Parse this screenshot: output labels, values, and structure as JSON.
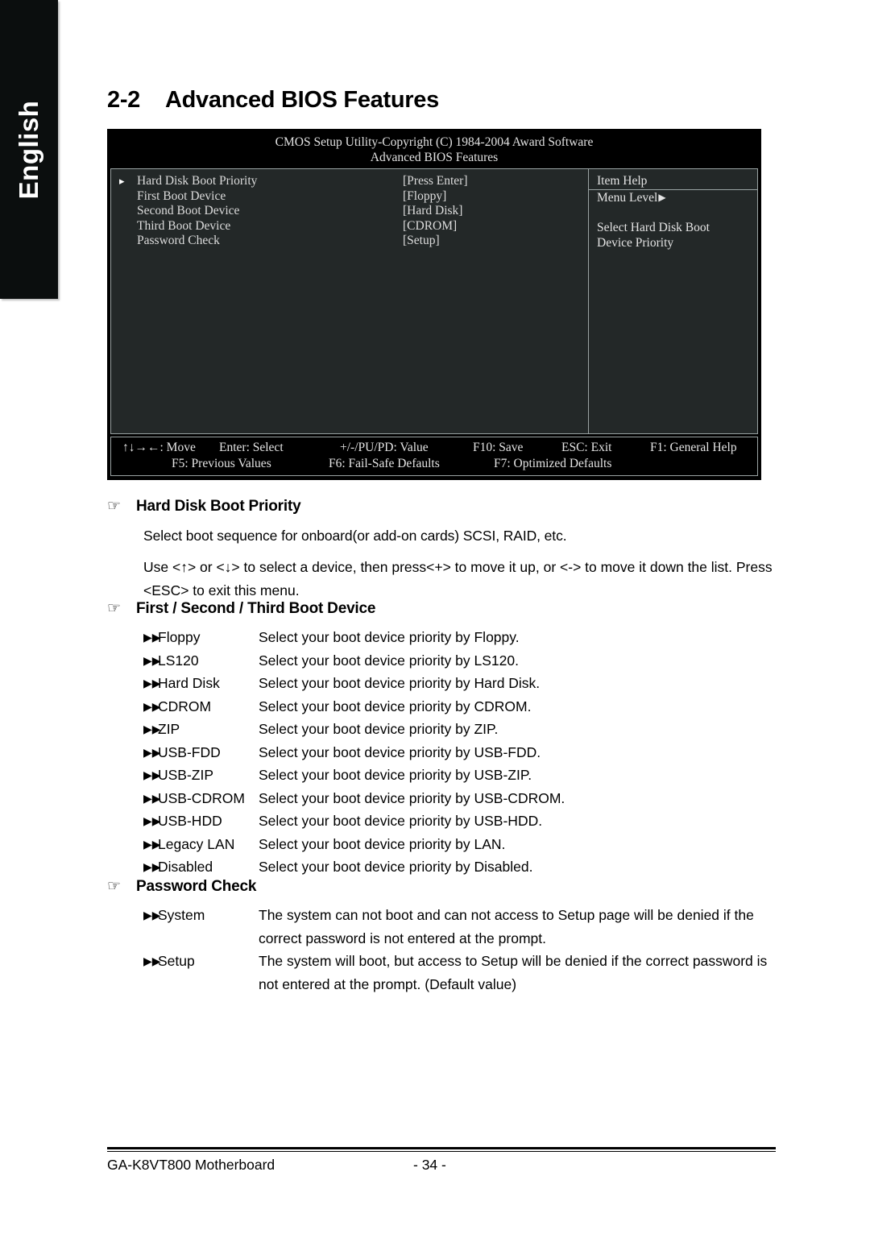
{
  "language_tab": {
    "label": "English"
  },
  "chapter": {
    "number": "2-2",
    "title": "Advanced BIOS Features"
  },
  "bios_screen": {
    "title": "CMOS Setup Utility-Copyright (C) 1984-2004 Award Software",
    "subtitle": "Advanced BIOS Features",
    "options": [
      {
        "arrow": "▸",
        "label": "Hard Disk Boot Priority",
        "value": "[Press Enter]"
      },
      {
        "arrow": "",
        "label": "First Boot Device",
        "value": "[Floppy]"
      },
      {
        "arrow": "",
        "label": "Second Boot Device",
        "value": "[Hard Disk]"
      },
      {
        "arrow": "",
        "label": "Third Boot Device",
        "value": "[CDROM]"
      },
      {
        "arrow": "",
        "label": "Password Check",
        "value": "[Setup]"
      }
    ],
    "item_help": {
      "heading": "Item Help",
      "menu_level_label": "Menu Level",
      "menu_level_arrow": "▶",
      "description_line1": "Select Hard Disk Boot",
      "description_line2": "Device Priority"
    },
    "footer": {
      "row1": [
        "↑↓→←: Move",
        "Enter: Select",
        "+/-/PU/PD: Value",
        "F10: Save",
        "ESC: Exit",
        "F1: General Help"
      ],
      "row2": [
        "F5: Previous Values",
        "F6: Fail-Safe Defaults",
        "F7: Optimized Defaults"
      ]
    }
  },
  "sections": {
    "hard_disk_boot_priority": {
      "icon": "pointing-hand",
      "heading": "Hard Disk Boot Priority",
      "paragraph1": "Select boot sequence for onboard(or add-on cards) SCSI, RAID, etc.",
      "paragraph2_line1": "Use <↑> or <↓> to select a device, then press<+> to move it up, or <-> to move it down the list. Press",
      "paragraph2_line2": "<ESC> to exit this menu."
    },
    "boot_device": {
      "icon": "pointing-hand",
      "heading": "First / Second / Third Boot Device",
      "bullet": "▶▶",
      "items": [
        {
          "term": "Floppy",
          "desc": "Select your boot device priority by Floppy."
        },
        {
          "term": "LS120",
          "desc": "Select your boot device priority by LS120."
        },
        {
          "term": "Hard Disk",
          "desc": "Select your boot device priority by Hard Disk."
        },
        {
          "term": "CDROM",
          "desc": "Select your boot device priority by CDROM."
        },
        {
          "term": "ZIP",
          "desc": "Select your boot device priority by ZIP."
        },
        {
          "term": "USB-FDD",
          "desc": "Select your boot device priority by USB-FDD."
        },
        {
          "term": "USB-ZIP",
          "desc": "Select your boot device priority by USB-ZIP."
        },
        {
          "term": "USB-CDROM",
          "desc": "Select your boot device priority by USB-CDROM."
        },
        {
          "term": "USB-HDD",
          "desc": "Select your boot device priority by USB-HDD."
        },
        {
          "term": "Legacy LAN",
          "desc": "Select your boot device priority by LAN."
        },
        {
          "term": "Disabled",
          "desc": "Select your boot device priority by Disabled."
        }
      ]
    },
    "password_check": {
      "icon": "pointing-hand",
      "heading": "Password Check",
      "bullet": "▶▶",
      "items": [
        {
          "term": "System",
          "desc_line1": "The system can not boot and can not access to Setup page will be denied if the",
          "desc_line2": "correct password is not entered at the prompt."
        },
        {
          "term": "Setup",
          "desc_line1": "The system will boot, but access to Setup will be denied if the correct password is",
          "desc_line2": "not entered at the prompt. (Default value)"
        }
      ]
    }
  },
  "page_footer": {
    "product": "GA-K8VT800 Motherboard",
    "page_number": "- 34 -"
  }
}
